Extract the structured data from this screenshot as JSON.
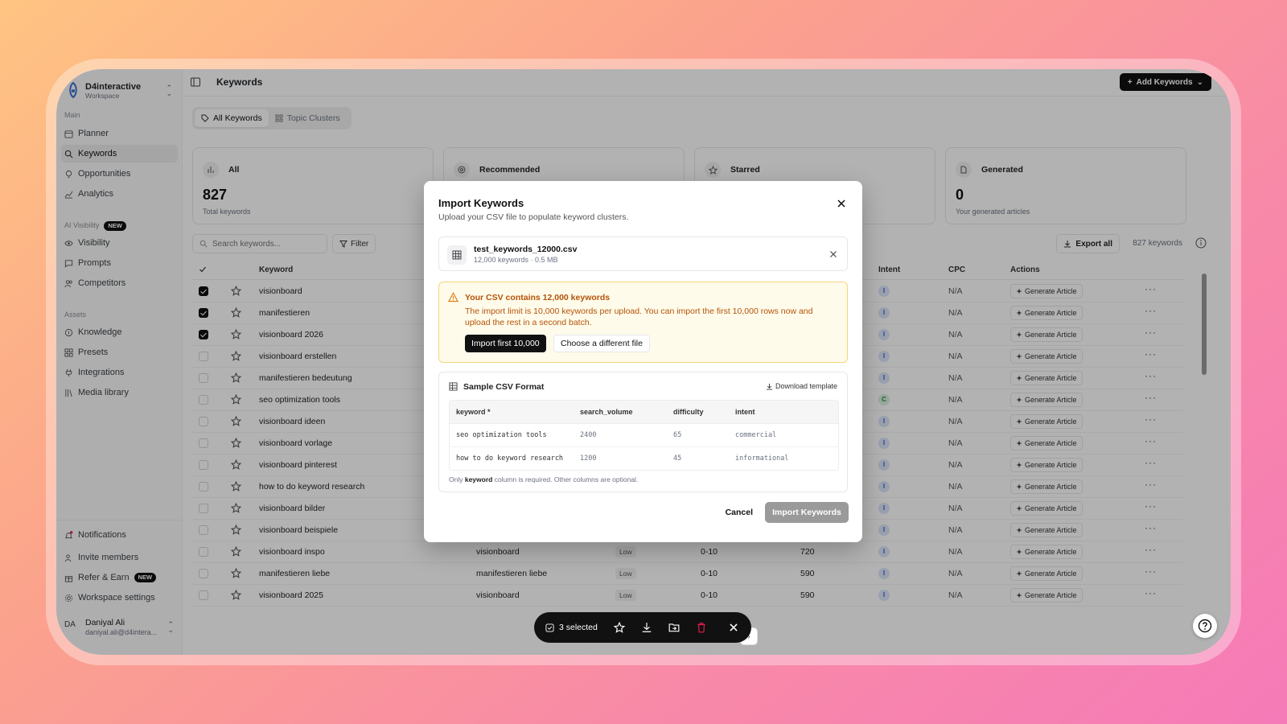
{
  "workspace": {
    "name": "D4interactive",
    "sub": "Workspace"
  },
  "sidebar": {
    "main_label": "Main",
    "main_items": [
      "Planner",
      "Keywords",
      "Opportunities",
      "Analytics"
    ],
    "ai_label": "AI Visibility",
    "ai_badge": "NEW",
    "ai_items": [
      "Visibility",
      "Prompts",
      "Competitors"
    ],
    "assets_label": "Assets",
    "assets_items": [
      "Knowledge",
      "Presets",
      "Integrations",
      "Media library"
    ],
    "bottom_items": [
      "Notifications",
      "Invite members",
      "Refer & Earn",
      "Workspace settings"
    ],
    "refer_badge": "NEW"
  },
  "user": {
    "initials": "DA",
    "name": "Daniyal Ali",
    "email": "daniyal.ali@d4intera..."
  },
  "header": {
    "title": "Keywords",
    "add_button": "Add Keywords"
  },
  "tabs": [
    "All Keywords",
    "Topic Clusters"
  ],
  "cards": [
    {
      "label": "All",
      "value": "827",
      "sub": "Total keywords"
    },
    {
      "label": "Recommended",
      "value": "",
      "sub": ""
    },
    {
      "label": "Starred",
      "value": "",
      "sub": ""
    },
    {
      "label": "Generated",
      "value": "0",
      "sub": "Your generated articles"
    }
  ],
  "toolbar": {
    "search_placeholder": "Search keywords...",
    "filter": "Filter",
    "export": "Export all",
    "count": "827 keywords"
  },
  "table": {
    "headers": {
      "keyword": "Keyword",
      "intent": "Intent",
      "cpc": "CPC",
      "actions": "Actions"
    },
    "generate_label": "Generate Article",
    "rows": [
      {
        "keyword": "visionboard",
        "checked": true,
        "topic": "",
        "difficulty": "",
        "kd": "",
        "volume": "",
        "intent": "I",
        "cpc": "N/A"
      },
      {
        "keyword": "manifestieren",
        "checked": true,
        "topic": "",
        "difficulty": "",
        "kd": "",
        "volume": "",
        "intent": "I",
        "cpc": "N/A"
      },
      {
        "keyword": "visionboard 2026",
        "checked": true,
        "topic": "",
        "difficulty": "",
        "kd": "",
        "volume": "",
        "intent": "I",
        "cpc": "N/A"
      },
      {
        "keyword": "visionboard erstellen",
        "checked": false,
        "topic": "",
        "difficulty": "",
        "kd": "",
        "volume": "",
        "intent": "I",
        "cpc": "N/A"
      },
      {
        "keyword": "manifestieren bedeutung",
        "checked": false,
        "topic": "",
        "difficulty": "",
        "kd": "",
        "volume": "",
        "intent": "I",
        "cpc": "N/A"
      },
      {
        "keyword": "seo optimization tools",
        "checked": false,
        "topic": "",
        "difficulty": "",
        "kd": "",
        "volume": "",
        "intent": "C",
        "cpc": "N/A"
      },
      {
        "keyword": "visionboard ideen",
        "checked": false,
        "topic": "",
        "difficulty": "",
        "kd": "",
        "volume": "",
        "intent": "I",
        "cpc": "N/A"
      },
      {
        "keyword": "visionboard vorlage",
        "checked": false,
        "topic": "",
        "difficulty": "",
        "kd": "",
        "volume": "",
        "intent": "I",
        "cpc": "N/A"
      },
      {
        "keyword": "visionboard pinterest",
        "checked": false,
        "topic": "",
        "difficulty": "",
        "kd": "",
        "volume": "",
        "intent": "I",
        "cpc": "N/A"
      },
      {
        "keyword": "how to do keyword research",
        "checked": false,
        "topic": "",
        "difficulty": "",
        "kd": "",
        "volume": "",
        "intent": "I",
        "cpc": "N/A"
      },
      {
        "keyword": "visionboard bilder",
        "checked": false,
        "topic": "",
        "difficulty": "",
        "kd": "",
        "volume": "",
        "intent": "I",
        "cpc": "N/A"
      },
      {
        "keyword": "visionboard beispiele",
        "checked": false,
        "topic": "",
        "difficulty": "",
        "kd": "",
        "volume": "",
        "intent": "I",
        "cpc": "N/A"
      },
      {
        "keyword": "visionboard inspo",
        "checked": false,
        "topic": "visionboard",
        "difficulty": "Low",
        "kd": "0-10",
        "volume": "720",
        "intent": "I",
        "cpc": "N/A"
      },
      {
        "keyword": "manifestieren liebe",
        "checked": false,
        "topic": "manifestieren liebe",
        "difficulty": "Low",
        "kd": "0-10",
        "volume": "590",
        "intent": "I",
        "cpc": "N/A"
      },
      {
        "keyword": "visionboard 2025",
        "checked": false,
        "topic": "visionboard",
        "difficulty": "Low",
        "kd": "0-10",
        "volume": "590",
        "intent": "I",
        "cpc": "N/A"
      }
    ]
  },
  "bulk": {
    "selected": "3 selected"
  },
  "modal": {
    "title": "Import Keywords",
    "subtitle": "Upload your CSV file to populate keyword clusters.",
    "file_name": "test_keywords_12000.csv",
    "file_meta": "12,000 keywords · 0.5 MB",
    "warning_title": "Your CSV contains 12,000 keywords",
    "warning_text": "The import limit is 10,000 keywords per upload. You can import the first 10,000 rows now and upload the rest in a second batch.",
    "import_first": "Import first 10,000",
    "choose_file": "Choose a different file",
    "sample_title": "Sample CSV Format",
    "download_template": "Download template",
    "sample_headers": [
      "keyword",
      "search_volume",
      "difficulty",
      "intent"
    ],
    "sample_rows": [
      [
        "seo optimization tools",
        "2400",
        "65",
        "commercial"
      ],
      [
        "how to do keyword research",
        "1200",
        "45",
        "informational"
      ]
    ],
    "note_prefix": "Only ",
    "note_bold": "keyword",
    "note_suffix": " column is required. Other columns are optional.",
    "cancel": "Cancel",
    "import": "Import Keywords"
  }
}
